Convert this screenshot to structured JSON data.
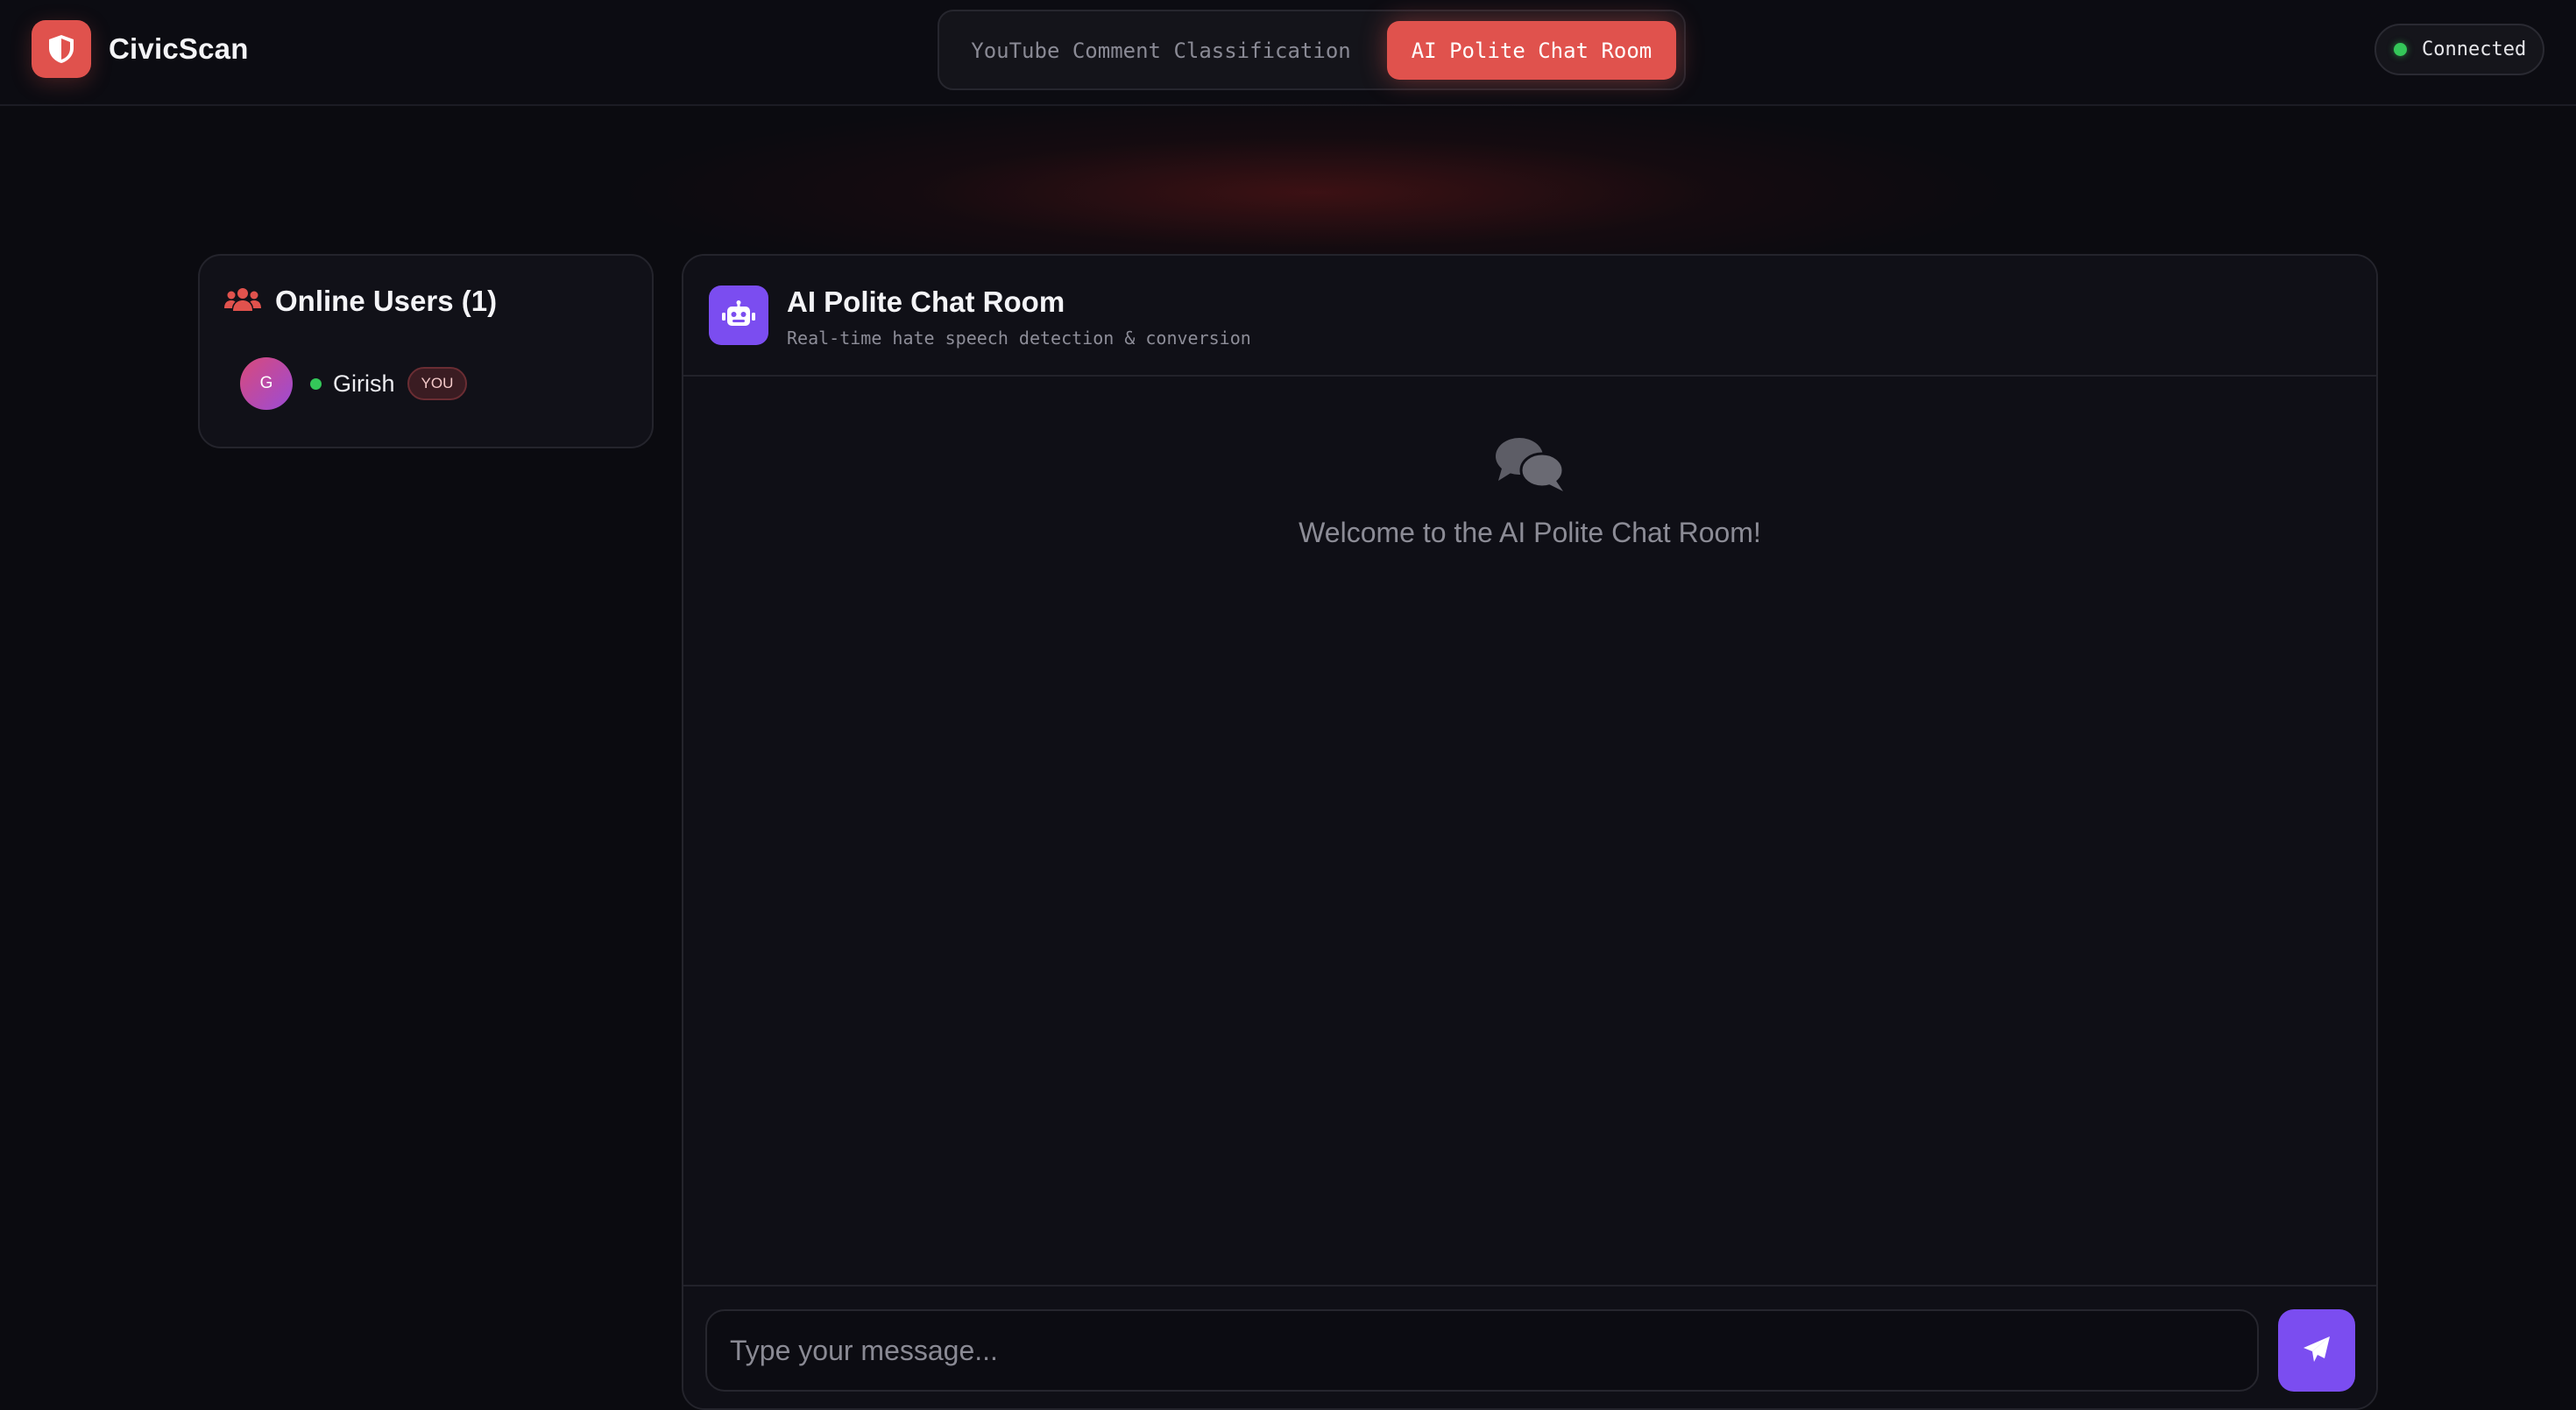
{
  "app": {
    "name": "CivicScan"
  },
  "nav": {
    "tabs": [
      {
        "label": "YouTube Comment Classification",
        "active": false
      },
      {
        "label": "AI Polite Chat Room",
        "active": true
      }
    ]
  },
  "connection": {
    "status": "Connected"
  },
  "users_panel": {
    "title": "Online Users (1)",
    "users": [
      {
        "initial": "G",
        "name": "Girish",
        "badge": "YOU",
        "online": true
      }
    ]
  },
  "chat": {
    "title": "AI Polite Chat Room",
    "subtitle": "Real-time hate speech detection & conversion",
    "welcome": "Welcome to the AI Polite Chat Room!",
    "input_placeholder": "Type your message...",
    "input_value": ""
  },
  "colors": {
    "accent_red": "#e0524d",
    "accent_purple": "#7b4df0",
    "online_green": "#34c759",
    "background": "#0b0b10"
  },
  "icons": {
    "brand": "shield-icon",
    "users": "users-icon",
    "bot": "robot-icon",
    "welcome": "chat-bubbles-icon",
    "send": "paper-plane-icon"
  }
}
